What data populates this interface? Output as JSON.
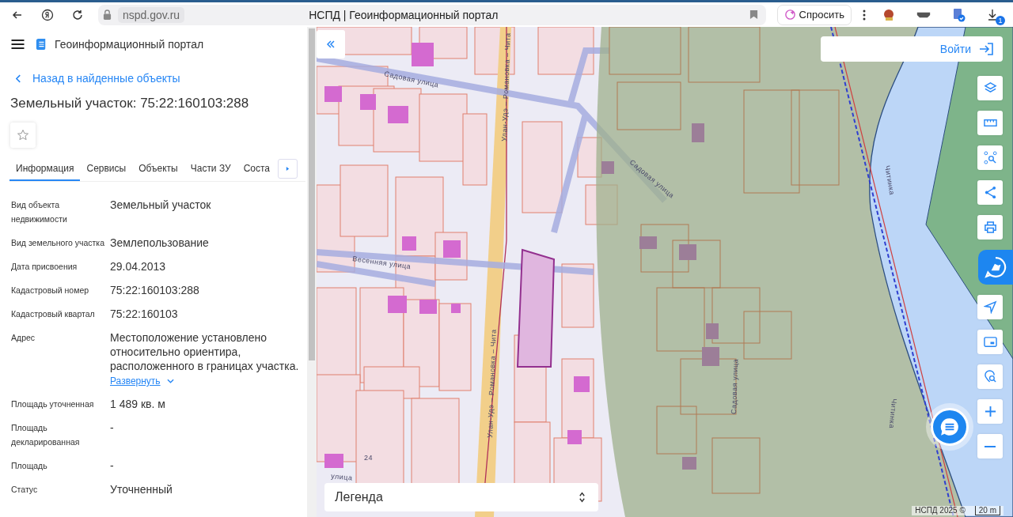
{
  "browser": {
    "url": "nspd.gov.ru",
    "title": "НСПД | Геоинформационный портал",
    "ask_button": "Спросить",
    "download_badge": "1"
  },
  "sidebar": {
    "app_title": "Геоинформационный портал",
    "back_link": "Назад в найденные объекты",
    "heading": "Земельный участок: 75:22:160103:288",
    "tabs": [
      {
        "label": "Информация",
        "selected": true
      },
      {
        "label": "Сервисы",
        "selected": false
      },
      {
        "label": "Объекты",
        "selected": false
      },
      {
        "label": "Части ЗУ",
        "selected": false
      },
      {
        "label": "Соста",
        "selected": false
      }
    ],
    "properties": [
      {
        "label": "Вид объекта недвижимости",
        "value": "Земельный участок"
      },
      {
        "label": "Вид земельного участка",
        "value": "Землепользование"
      },
      {
        "label": "Дата присвоения",
        "value": "29.04.2013"
      },
      {
        "label": "Кадастровый номер",
        "value": "75:22:160103:288"
      },
      {
        "label": "Кадастровый квартал",
        "value": "75:22:160103"
      },
      {
        "label": "Адрес",
        "value": "Местоположение установлено относительно ориентира, расположенного в границах участка.",
        "expand_link": "Развернуть"
      },
      {
        "label": "Площадь уточненная",
        "value": "1 489 кв. м"
      },
      {
        "label": "Площадь декларированная",
        "value": "-"
      },
      {
        "label": "Площадь",
        "value": "-"
      },
      {
        "label": "Статус",
        "value": "Уточненный"
      }
    ]
  },
  "map": {
    "login_button": "Войти",
    "legend": "Легенда",
    "attribution": "НСПД 2025 ©",
    "scale": "20 m",
    "labels": [
      {
        "text": "Садовая улица"
      },
      {
        "text": "Садовая улица"
      },
      {
        "text": "Садовая улица"
      },
      {
        "text": "Весенняя улица"
      },
      {
        "text": "Улан-Удэ – Романовка – Чита"
      },
      {
        "text": "Улан-Удэ – Романовка – Чита"
      },
      {
        "text": "улица"
      },
      {
        "text": "Читинка"
      },
      {
        "text": "Читинка"
      },
      {
        "text": "24"
      }
    ]
  }
}
